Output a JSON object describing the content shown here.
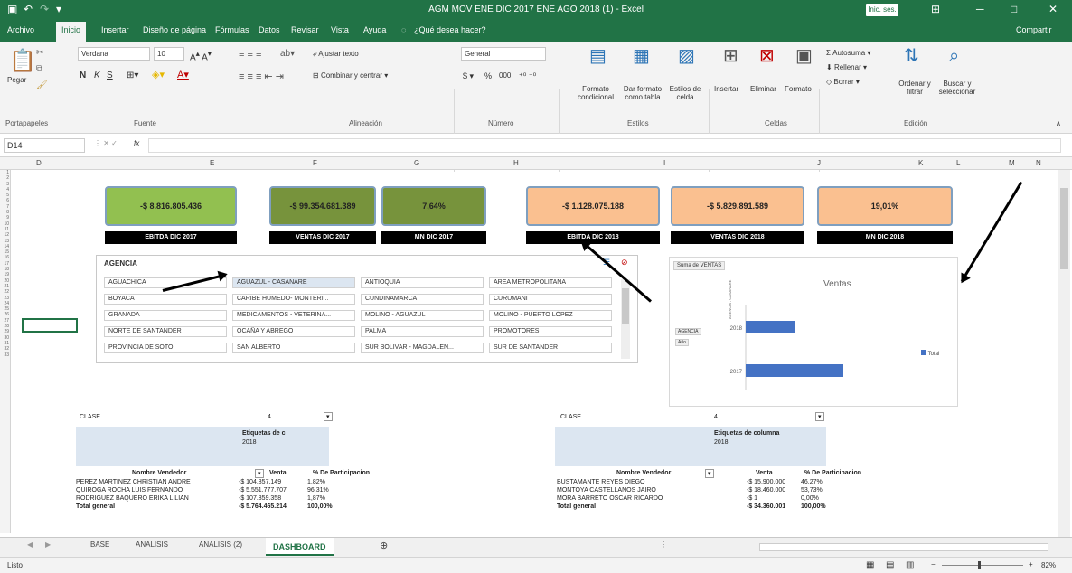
{
  "window": {
    "title": "AGM MOV ENE DIC 2017 ENE AGO 2018 (1) - Excel",
    "signin": "Inic. ses.",
    "min": "─",
    "restore": "□",
    "close": "✕",
    "ribbon_display": "⊞"
  },
  "menu": {
    "items": [
      "Archivo",
      "Inicio",
      "Insertar",
      "Diseño de página",
      "Fórmulas",
      "Datos",
      "Revisar",
      "Vista",
      "Ayuda"
    ],
    "tell": "¿Qué desea hacer?",
    "share": "Compartir"
  },
  "ribbon": {
    "clipboard": {
      "paste": "Pegar",
      "group": "Portapapeles"
    },
    "font": {
      "name": "Verdana",
      "size": "10",
      "group": "Fuente",
      "bold": "N",
      "italic": "K",
      "underline": "S"
    },
    "align": {
      "wrap": "Ajustar texto",
      "merge": "Combinar y centrar",
      "group": "Alineación"
    },
    "number": {
      "format": "General",
      "group": "Número",
      "pct": "%",
      "thousands": "000"
    },
    "styles": {
      "cond": "Formato condicional",
      "table": "Dar formato como tabla",
      "cell": "Estilos de celda",
      "group": "Estilos"
    },
    "cells": {
      "insert": "Insertar",
      "delete": "Eliminar",
      "format": "Formato",
      "group": "Celdas"
    },
    "editing": {
      "autosum": "Autosuma",
      "fill": "Rellenar",
      "clear": "Borrar",
      "sort": "Ordenar y filtrar",
      "find": "Buscar y seleccionar",
      "group": "Edición"
    }
  },
  "formula_bar": {
    "namebox": "D14",
    "fx": "fx",
    "value": ""
  },
  "columns": [
    "D",
    "E",
    "F",
    "G",
    "H",
    "I",
    "J",
    "K",
    "L",
    "M",
    "N"
  ],
  "rows": [
    "1",
    "2",
    "3",
    "4",
    "5",
    "6",
    "7",
    "8",
    "9",
    "10",
    "11",
    "12",
    "13",
    "14",
    "15",
    "16",
    "17",
    "18",
    "19",
    "20",
    "21",
    "22",
    "23",
    "24",
    "25",
    "26",
    "27",
    "28",
    "29",
    "30",
    "31",
    "32",
    "33"
  ],
  "cards": [
    {
      "value": "-$ 8.816.805.436",
      "label": "EBITDA DIC 2017",
      "color": "#92c050"
    },
    {
      "value": "-$ 99.354.681.389",
      "label": "VENTAS DIC 2017",
      "color": "#77933c"
    },
    {
      "value": "7,64%",
      "label": "MN DIC 2017",
      "color": "#77933c"
    },
    {
      "value": "-$ 1.128.075.188",
      "label": "EBITDA DIC 2018",
      "color": "#fac090"
    },
    {
      "value": "-$ 5.829.891.589",
      "label": "VENTAS DIC 2018",
      "color": "#fac090"
    },
    {
      "value": "19,01%",
      "label": "MN DIC 2018",
      "color": "#fac090"
    }
  ],
  "slicer": {
    "title": "AGENCIA",
    "items": [
      "AGUACHICA",
      "AGUAZUL - CASANARE",
      "ANTIOQUIA",
      "AREA METROPOLITANA",
      "BOYACA",
      "CARIBE HUMEDO- MONTERI...",
      "CUNDINAMARCA",
      "CURUMANI",
      "GRANADA",
      "MEDICAMENTOS - VETERINA...",
      "MOLINO - AGUAZUL",
      "MOLINO - PUERTO LÓPEZ",
      "NORTE DE SANTANDER",
      "OCAÑA Y ABREGO",
      "PALMA",
      "PROMOTORES",
      "PROVINCIA DE SOTO",
      "SAN ALBERTO",
      "SUR BOLIVAR - MAGDALEN...",
      "SUR DE SANTANDER"
    ],
    "selected": 1
  },
  "chart_data": {
    "type": "bar",
    "title": "Ventas",
    "button": "Suma de VENTAS",
    "filters": [
      "AGENCIA",
      "Año"
    ],
    "categories": [
      "2018",
      "2017"
    ],
    "series": [
      {
        "name": "Total",
        "values": [
          0.3,
          0.6
        ]
      }
    ],
    "ylabel": "AGENCIA - CASANARE",
    "legend": "right"
  },
  "pivot_left": {
    "clase_label": "CLASE",
    "clase_value": "4",
    "col_label": "Etiquetas de c",
    "year": "2018",
    "headers": [
      "Nombre Vendedor",
      "Venta",
      "% De Participacion"
    ],
    "rows": [
      [
        "PEREZ MARTINEZ CHRISTIAN ANDRE",
        "-$ 104.857.149",
        "1,82%"
      ],
      [
        "QUIROGA ROCHA LUIS FERNANDO",
        "-$ 5.551.777.707",
        "96,31%"
      ],
      [
        "RODRIGUEZ BAQUERO ERIKA LILIAN",
        "-$ 107.859.358",
        "1,87%"
      ]
    ],
    "total": [
      "Total general",
      "-$ 5.764.465.214",
      "100,00%"
    ]
  },
  "pivot_right": {
    "clase_label": "CLASE",
    "clase_value": "4",
    "col_label": "Etiquetas de columna",
    "year": "2018",
    "headers": [
      "Nombre Vendedor",
      "Venta",
      "% De Participacion"
    ],
    "rows": [
      [
        "BUSTAMANTE REYES DIEGO",
        "-$ 15.900.000",
        "46,27%"
      ],
      [
        "MONTOYA CASTELLANOS JAIRO",
        "-$ 18.460.000",
        "53,73%"
      ],
      [
        "MORA BARRETO OSCAR RICARDO",
        "-$ 1",
        "0,00%"
      ]
    ],
    "total": [
      "Total general",
      "-$ 34.360.001",
      "100,00%"
    ]
  },
  "tabs": [
    "BASE",
    "ANALISIS",
    "ANALISIS (2)",
    "DASHBOARD"
  ],
  "status": {
    "mode": "Listo",
    "zoom": "82%"
  }
}
